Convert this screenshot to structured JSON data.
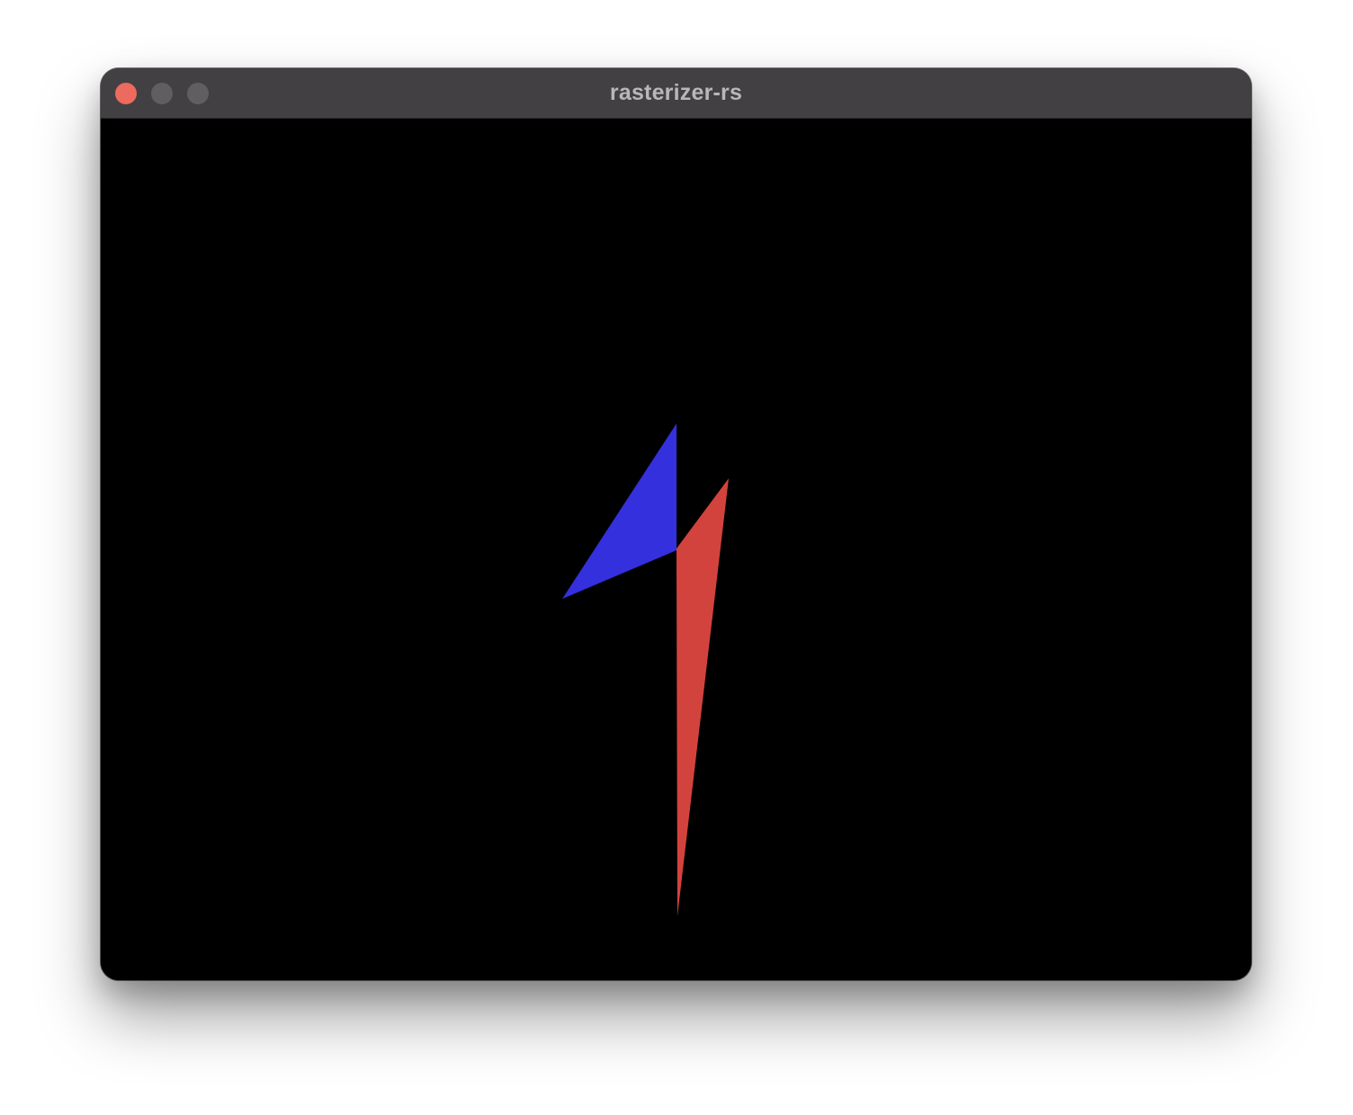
{
  "window": {
    "title": "rasterizer-rs",
    "controls": {
      "close_color": "#ec6a5e",
      "minimize_color": "#605e60",
      "zoom_color": "#605e60"
    }
  },
  "canvas": {
    "background": "#000000",
    "triangles": [
      {
        "name": "blue-triangle",
        "color": "#3430dd"
      },
      {
        "name": "red-triangle",
        "color": "#d3433d"
      }
    ]
  }
}
